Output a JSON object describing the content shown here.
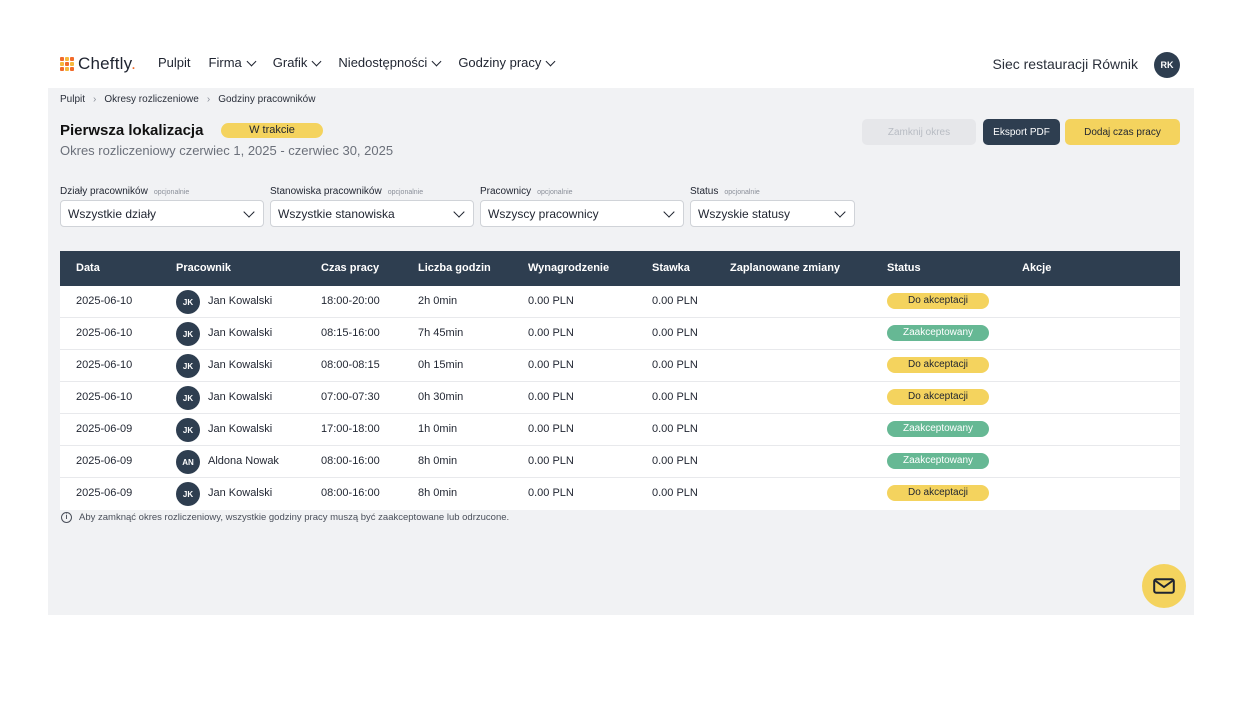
{
  "app": {
    "logo_text": "Cheftly",
    "logo_dot": "."
  },
  "nav": [
    {
      "label": "Pulpit",
      "dropdown": false
    },
    {
      "label": "Firma",
      "dropdown": true
    },
    {
      "label": "Grafik",
      "dropdown": true
    },
    {
      "label": "Niedostępności",
      "dropdown": true
    },
    {
      "label": "Godziny pracy",
      "dropdown": true
    }
  ],
  "header": {
    "org_name": "Siec restauracji Równik",
    "user_initials": "RK"
  },
  "breadcrumb": [
    "Pulpit",
    "Okresy rozliczeniowe",
    "Godziny pracowników"
  ],
  "page": {
    "title": "Pierwsza lokalizacja",
    "status_badge": "W trakcie",
    "subtitle": "Okres rozliczeniowy czerwiec 1, 2025 - czerwiec 30, 2025"
  },
  "actions": {
    "close_period": "Zamknij okres",
    "export_pdf": "Eksport PDF",
    "add_hours": "Dodaj czas pracy"
  },
  "filters": [
    {
      "label": "Działy pracowników",
      "optional": "opcjonalnie",
      "value": "Wszystkie działy"
    },
    {
      "label": "Stanowiska pracowników",
      "optional": "opcjonalnie",
      "value": "Wszystkie stanowiska"
    },
    {
      "label": "Pracownicy",
      "optional": "opcjonalnie",
      "value": "Wszyscy pracownicy"
    },
    {
      "label": "Status",
      "optional": "opcjonalnie",
      "value": "Wszyskie statusy"
    }
  ],
  "table": {
    "columns": [
      "Data",
      "Pracownik",
      "Czas pracy",
      "Liczba godzin",
      "Wynagrodzenie",
      "Stawka",
      "Zaplanowane zmiany",
      "Status",
      "Akcje"
    ],
    "rows": [
      {
        "date": "2025-06-10",
        "initials": "JK",
        "name": "Jan Kowalski",
        "time": "18:00-20:00",
        "hours": "2h 0min",
        "pay": "0.00 PLN",
        "rate": "0.00 PLN",
        "planned": "",
        "status": "Do akceptacji",
        "status_type": "pending"
      },
      {
        "date": "2025-06-10",
        "initials": "JK",
        "name": "Jan Kowalski",
        "time": "08:15-16:00",
        "hours": "7h 45min",
        "pay": "0.00 PLN",
        "rate": "0.00 PLN",
        "planned": "",
        "status": "Zaakceptowany",
        "status_type": "accepted"
      },
      {
        "date": "2025-06-10",
        "initials": "JK",
        "name": "Jan Kowalski",
        "time": "08:00-08:15",
        "hours": "0h 15min",
        "pay": "0.00 PLN",
        "rate": "0.00 PLN",
        "planned": "",
        "status": "Do akceptacji",
        "status_type": "pending"
      },
      {
        "date": "2025-06-10",
        "initials": "JK",
        "name": "Jan Kowalski",
        "time": "07:00-07:30",
        "hours": "0h 30min",
        "pay": "0.00 PLN",
        "rate": "0.00 PLN",
        "planned": "",
        "status": "Do akceptacji",
        "status_type": "pending"
      },
      {
        "date": "2025-06-09",
        "initials": "JK",
        "name": "Jan Kowalski",
        "time": "17:00-18:00",
        "hours": "1h 0min",
        "pay": "0.00 PLN",
        "rate": "0.00 PLN",
        "planned": "",
        "status": "Zaakceptowany",
        "status_type": "accepted"
      },
      {
        "date": "2025-06-09",
        "initials": "AN",
        "name": "Aldona Nowak",
        "time": "08:00-16:00",
        "hours": "8h 0min",
        "pay": "0.00 PLN",
        "rate": "0.00 PLN",
        "planned": "",
        "status": "Zaakceptowany",
        "status_type": "accepted"
      },
      {
        "date": "2025-06-09",
        "initials": "JK",
        "name": "Jan Kowalski",
        "time": "08:00-16:00",
        "hours": "8h 0min",
        "pay": "0.00 PLN",
        "rate": "0.00 PLN",
        "planned": "",
        "status": "Do akceptacji",
        "status_type": "pending"
      }
    ]
  },
  "note": "Aby zamknąć okres rozliczeniowy, wszystkie godziny pracy muszą być zaakceptowane lub odrzucone.",
  "colors": {
    "navy": "#2e3e50",
    "yellow": "#f4d35e",
    "green": "#66b894",
    "orange": "#f26b2a"
  },
  "icons": {
    "info": "info-icon",
    "mail": "mail-icon",
    "chevron": "chevron-down-icon"
  }
}
